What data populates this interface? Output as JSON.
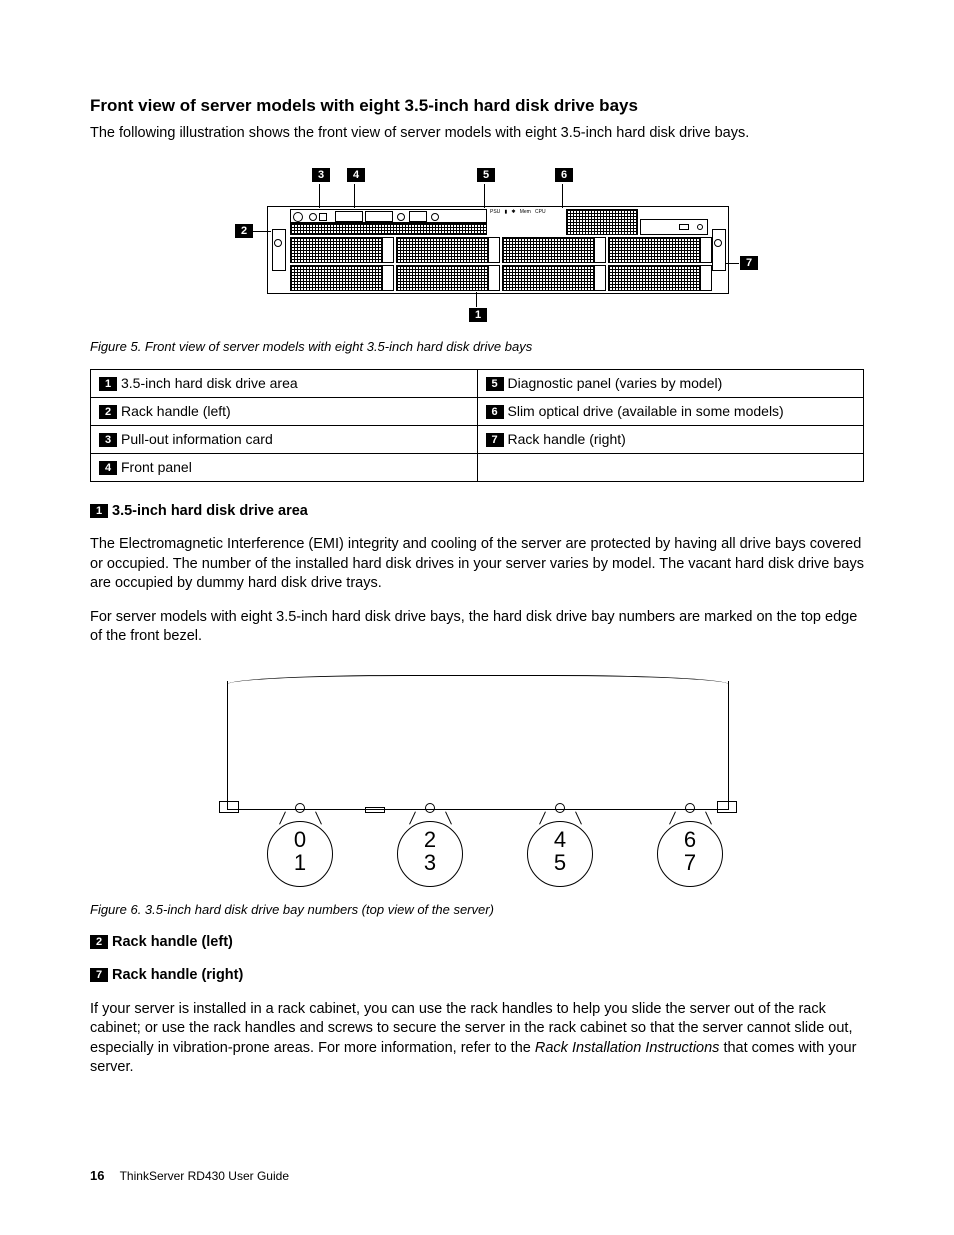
{
  "title": "Front view of server models with eight 3.5-inch hard disk drive bays",
  "intro": "The following illustration shows the front view of server models with eight 3.5-inch hard disk drive bays.",
  "figure5_caption": "Figure 5.  Front view of server models with eight 3.5-inch hard disk drive bays",
  "legend": {
    "r1c1_num": "1",
    "r1c1_txt": "3.5-inch hard disk drive area",
    "r1c2_num": "5",
    "r1c2_txt": "Diagnostic panel (varies by model)",
    "r2c1_num": "2",
    "r2c1_txt": "Rack handle (left)",
    "r2c2_num": "6",
    "r2c2_txt": "Slim optical drive (available in some models)",
    "r3c1_num": "3",
    "r3c1_txt": "Pull-out information card",
    "r3c2_num": "7",
    "r3c2_txt": "Rack handle (right)",
    "r4c1_num": "4",
    "r4c1_txt": "Front panel"
  },
  "sec1": {
    "num": "1",
    "heading": "3.5-inch hard disk drive area",
    "p1": "The Electromagnetic Interference (EMI) integrity and cooling of the server are protected by having all drive bays covered or occupied. The number of the installed hard disk drives in your server varies by model. The vacant hard disk drive bays are occupied by dummy hard disk drive trays.",
    "p2": "For server models with eight 3.5-inch hard disk drive bays, the hard disk drive bay numbers are marked on the top edge of the front bezel."
  },
  "figure6_caption": "Figure 6.  3.5-inch hard disk drive bay numbers (top view of the server)",
  "bay_pairs": [
    "0",
    "1",
    "2",
    "3",
    "4",
    "5",
    "6",
    "7"
  ],
  "sec2": {
    "num": "2",
    "heading": "Rack handle (left)"
  },
  "sec7": {
    "num": "7",
    "heading": "Rack handle (right)"
  },
  "rack_p_a": "If your server is installed in a rack cabinet, you can use the rack handles to help you slide the server out of the rack cabinet; or use the rack handles and screws to secure the server in the rack cabinet so that the server cannot slide out, especially in vibration-prone areas. For more information, refer to the ",
  "rack_p_b": "Rack Installation Instructions",
  "rack_p_c": " that comes with your server.",
  "callouts": {
    "c1": "1",
    "c2": "2",
    "c3": "3",
    "c4": "4",
    "c5": "5",
    "c6": "6",
    "c7": "7"
  },
  "footer": {
    "page": "16",
    "doc": "ThinkServer RD430 User Guide"
  }
}
